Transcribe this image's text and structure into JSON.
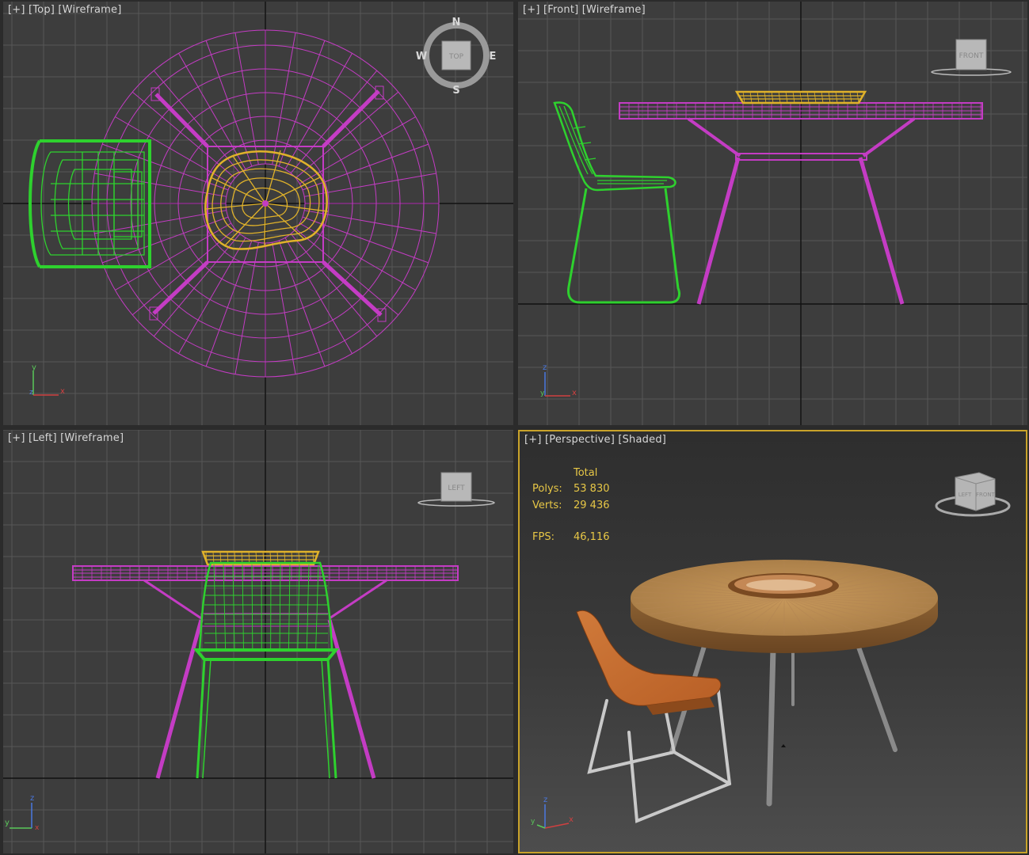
{
  "viewports": {
    "top": {
      "label": "[+] [Top] [Wireframe]",
      "cube": "TOP",
      "compass": {
        "n": "N",
        "s": "S",
        "e": "E",
        "w": "W"
      }
    },
    "front": {
      "label": "[+] [Front] [Wireframe]",
      "cube": "FRONT"
    },
    "left": {
      "label": "[+] [Left] [Wireframe]",
      "cube": "LEFT"
    },
    "perspective": {
      "label": "[+] [Perspective] [Shaded]",
      "cube_left": "LEFT",
      "cube_front": "FRONT"
    }
  },
  "axes": {
    "top": {
      "a": "y",
      "b": "x",
      "c": "z"
    },
    "front": {
      "a": "z",
      "b": "x",
      "c": "y"
    },
    "left": {
      "a": "z",
      "b": "y",
      "c": "x"
    },
    "perspective": {
      "a": "z",
      "b": "x",
      "c": "y"
    }
  },
  "stats": {
    "total_label": "Total",
    "polys_label": "Polys:",
    "polys_value": "53 830",
    "verts_label": "Verts:",
    "verts_value": "29 436",
    "fps_label": "FPS:",
    "fps_value": "46,116"
  },
  "colors": {
    "viewport_bg": "#3d3d3d",
    "grid": "#555555",
    "table_wire": "#c43cc4",
    "chair_wire": "#2ed12e",
    "bowl_wire": "#e0b22a",
    "active_border": "#c9a32a",
    "stats_text": "#e7c746"
  }
}
